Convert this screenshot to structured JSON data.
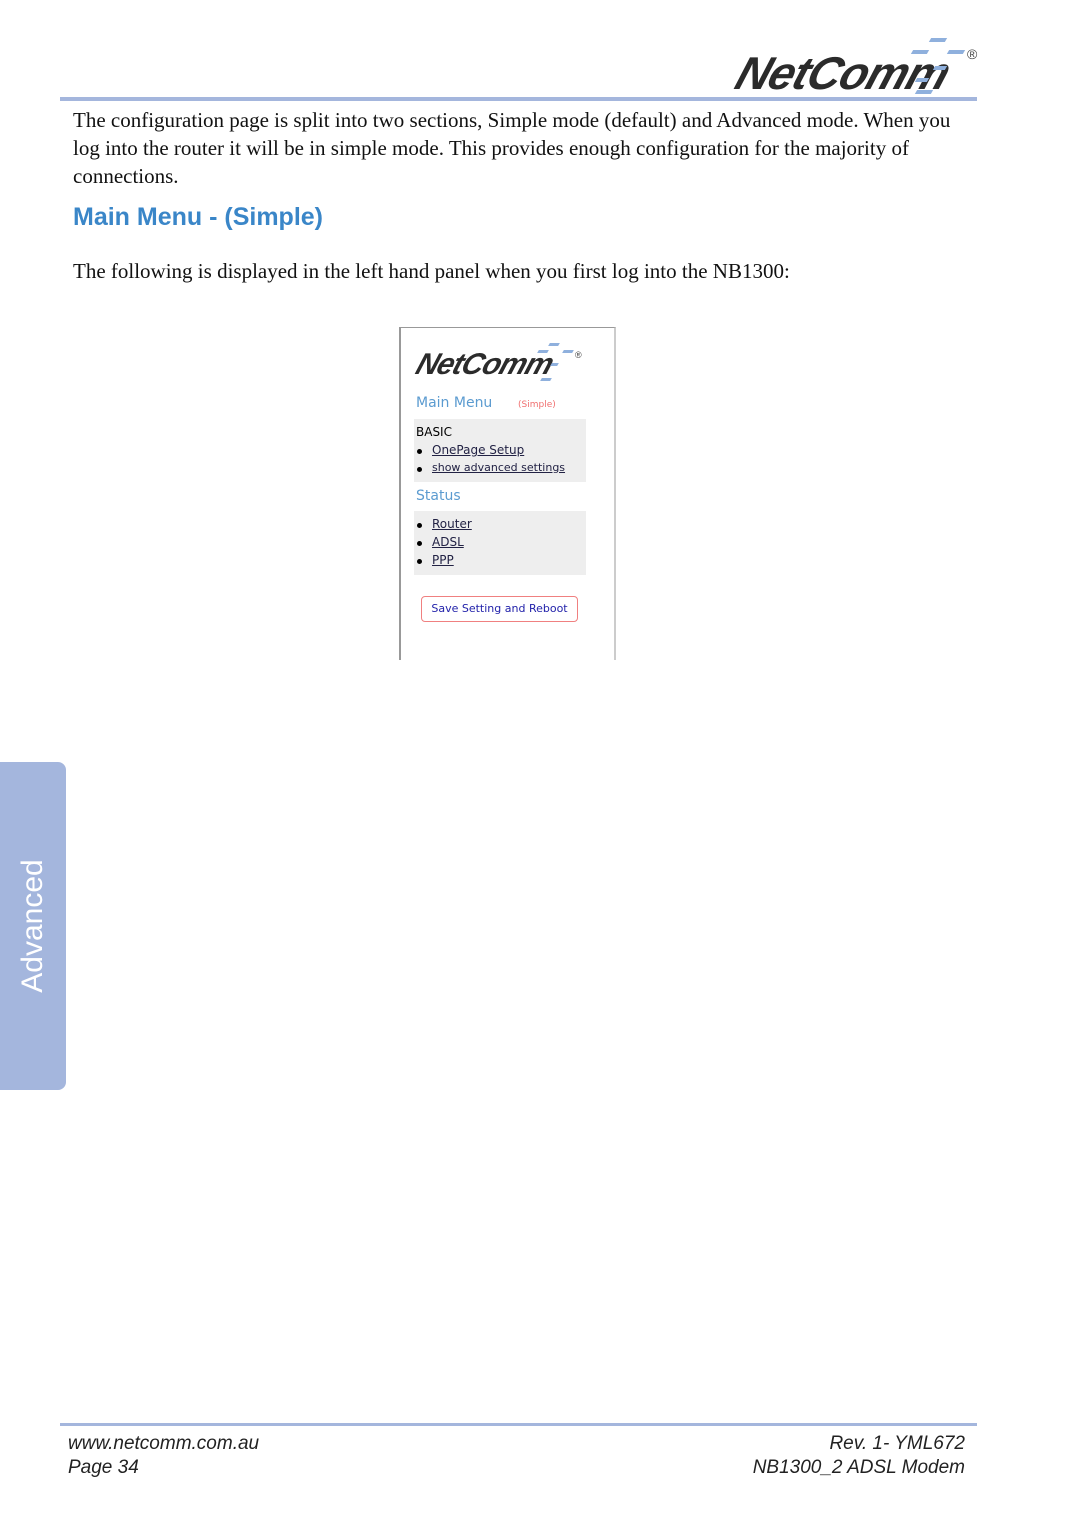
{
  "header": {
    "logo": "NetComm",
    "registered": "®"
  },
  "intro": "The configuration page is split into two sections, Simple mode (default) and Advanced mode. When you log into the router it will be in simple mode. This provides enough configuration for the majority of connections.",
  "heading": "Main Menu - (Simple)",
  "lead": "The following is displayed in the left hand panel when you first log into the NB1300:",
  "screenshot": {
    "logo": "NetComm",
    "title": "Main Menu",
    "mode": "(Simple)",
    "basic_label": "BASIC",
    "basic_links": [
      "OnePage Setup",
      "show advanced settings"
    ],
    "status_label": "Status",
    "status_links": [
      "Router",
      "ADSL",
      "PPP"
    ],
    "save_button": "Save Setting and Reboot"
  },
  "side_tab": "Advanced",
  "footer": {
    "url": "www.netcomm.com.au",
    "page": "Page 34",
    "rev": "Rev. 1- YML672",
    "product": "NB1300_2 ADSL Modem"
  },
  "colors": {
    "accent": "#3a86c8",
    "rule": "#a4b6dd"
  }
}
